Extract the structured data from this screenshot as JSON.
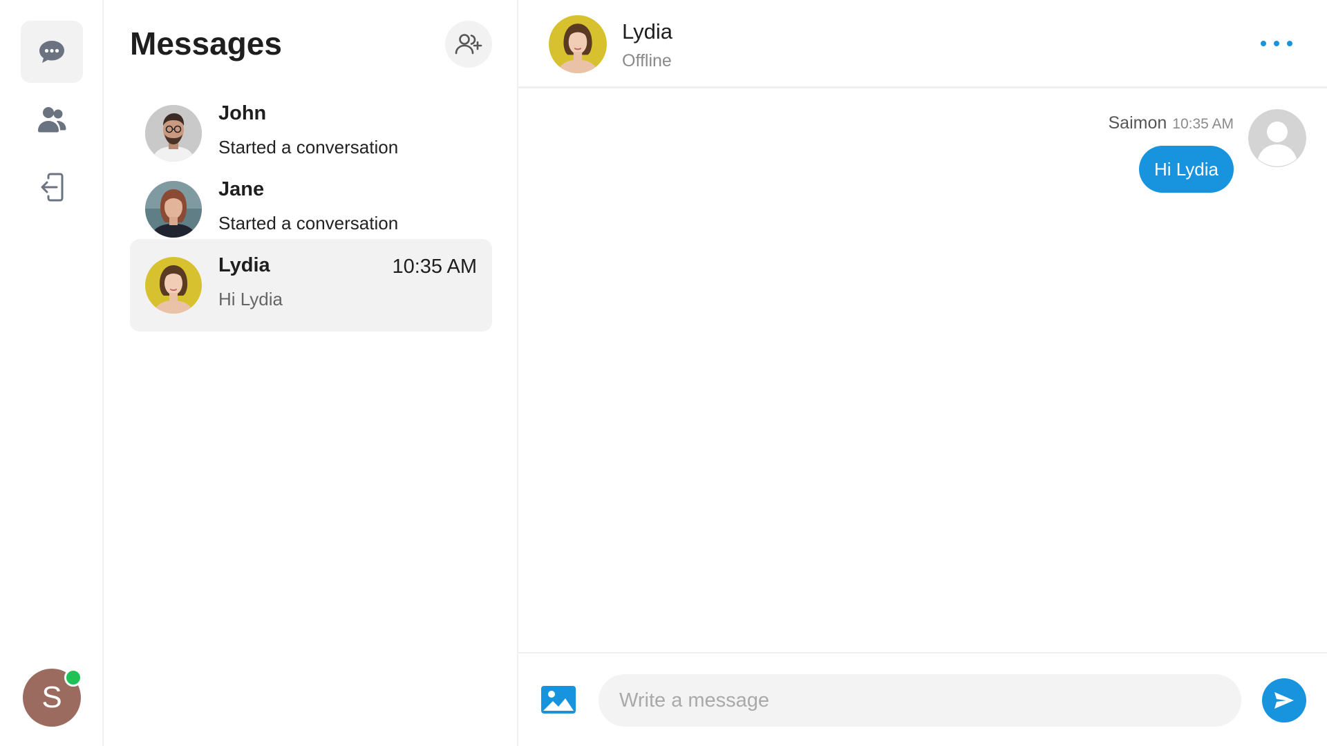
{
  "nav": {
    "items": [
      {
        "icon": "chat-bubble-icon",
        "active": true
      },
      {
        "icon": "users-icon",
        "active": false
      },
      {
        "icon": "logout-icon",
        "active": false
      }
    ],
    "user_avatar_letter": "S",
    "user_avatar_color": "#9c6b60",
    "online_color": "#1fc256"
  },
  "conversations": {
    "title": "Messages",
    "add_icon": "user-plus-icon",
    "items": [
      {
        "name": "John",
        "preview": "Started a conversation",
        "time": "",
        "active": false
      },
      {
        "name": "Jane",
        "preview": "Started a conversation",
        "time": "",
        "active": false
      },
      {
        "name": "Lydia",
        "preview": "Hi Lydia",
        "time": "10:35 AM",
        "active": true
      }
    ]
  },
  "chat": {
    "contact_name": "Lydia",
    "contact_status": "Offline",
    "more_icon": "more-horizontal-icon",
    "messages": [
      {
        "sender": "Saimon",
        "time": "10:35 AM",
        "text": "Hi Lydia"
      }
    ],
    "composer": {
      "image_icon": "image-icon",
      "placeholder": "Write a message",
      "value": "",
      "send_icon": "send-icon"
    }
  },
  "colors": {
    "accent": "#1794dd",
    "panel_bg": "#f2f2f2"
  }
}
